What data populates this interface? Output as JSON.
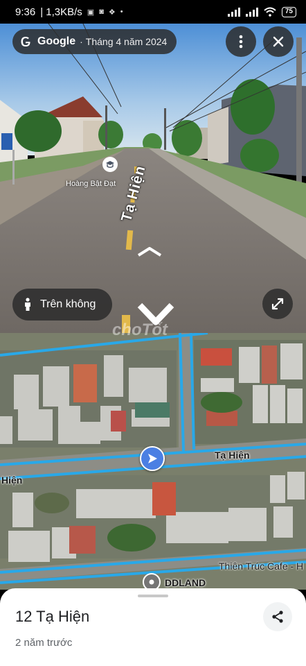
{
  "status_bar": {
    "time": "9:36",
    "speed": "| 1,3KB/s",
    "battery": "75",
    "icons": [
      "data-saver-icon",
      "shopping-bag-icon",
      "dropbox-icon",
      "dot-icon",
      "signal-icon",
      "signal-icon",
      "wifi-icon",
      "battery-icon"
    ]
  },
  "streetview": {
    "brand": "Google",
    "separator": "·",
    "capture_date": "Tháng 4 năm 2024",
    "place_label": "Hoàng Bật Đạt",
    "road_name": "Tạ Hiện",
    "aerial_button_label": "Trên không",
    "icons": [
      "google-g-icon",
      "more-vertical-icon",
      "close-icon",
      "person-icon",
      "expand-icon",
      "chevron-up-icon",
      "chevron-down-icon",
      "education-pin-icon"
    ]
  },
  "map": {
    "watermark": "choTốt",
    "street_labels": {
      "main_right": "Tạ Hiện",
      "main_left": "Hiện",
      "cafe": "Thiên Trúc Cafe - H",
      "poi": "DDLAND"
    },
    "route_color": "#29a8e8",
    "marker_color": "#4b7fe3"
  },
  "sheet": {
    "title": "12 Tạ Hiện",
    "subtitle": "2 năm trước"
  }
}
